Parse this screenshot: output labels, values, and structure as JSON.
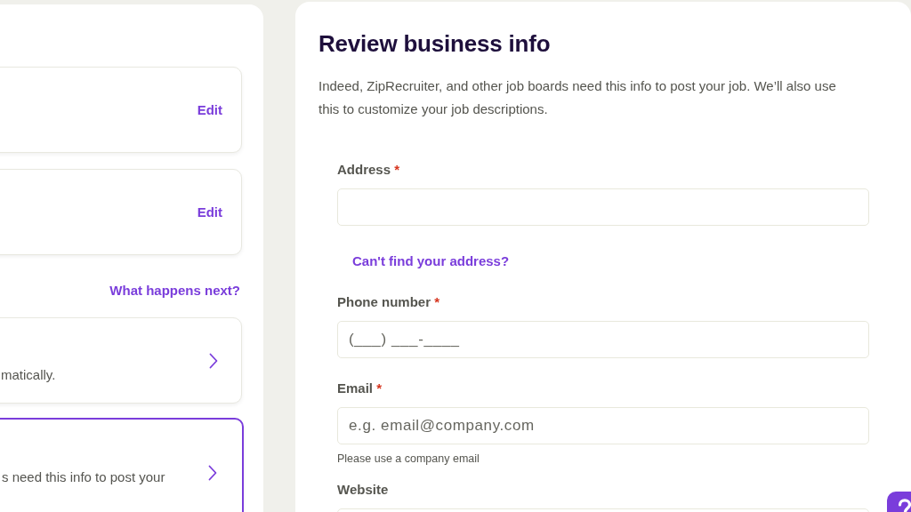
{
  "left_panel": {
    "summary_cards": [
      {
        "action": "Edit"
      },
      {
        "action": "Edit"
      }
    ],
    "next_steps_link": "What happens next?",
    "steps": [
      {
        "text": "matically.",
        "selected": false
      },
      {
        "text": "s need this info to post your",
        "selected": true
      }
    ]
  },
  "form_panel": {
    "title": "Review business info",
    "description": "Indeed, ZipRecruiter, and other job boards need this info to post your job. We’ll also use this to customize your job descriptions.",
    "required_mark": "*",
    "fields": [
      {
        "label": "Address",
        "required": true,
        "link": "Can't find your address?"
      },
      {
        "label": "Phone number",
        "required": true,
        "placeholder": "(___) ___-____"
      },
      {
        "label": "Email",
        "required": true,
        "placeholder": "e.g. email@company.com",
        "hint": "Please use a company email"
      },
      {
        "label": "Website",
        "required": false
      }
    ]
  }
}
